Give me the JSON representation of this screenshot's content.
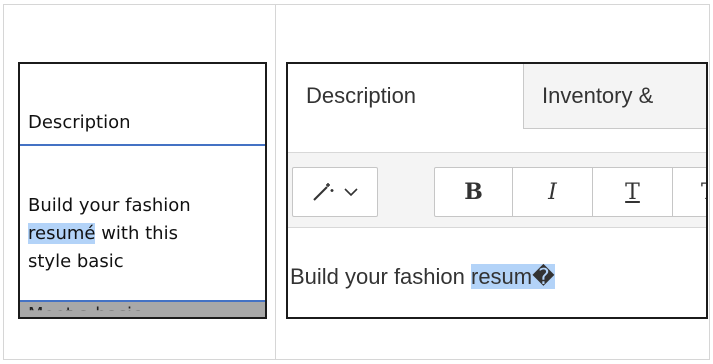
{
  "left": {
    "header": "Description",
    "body_line1": "Build your fashion",
    "body_line2_highlight": "resumé",
    "body_line2_rest": " with this",
    "body_line3": "style basic",
    "cut_line": "Meet a basic"
  },
  "right": {
    "tabs": [
      {
        "label": "Description"
      },
      {
        "label": "Inventory &"
      }
    ],
    "toolbar": {
      "magic_icon": "magic-wand-icon",
      "bold": "B",
      "italic": "I",
      "underline": "T",
      "more": "T"
    },
    "editor": {
      "text_prefix": "Build your fashion ",
      "text_highlight": "resum�"
    }
  },
  "colors": {
    "highlight": "#b3d3f8",
    "rule_blue": "#4472c4"
  }
}
